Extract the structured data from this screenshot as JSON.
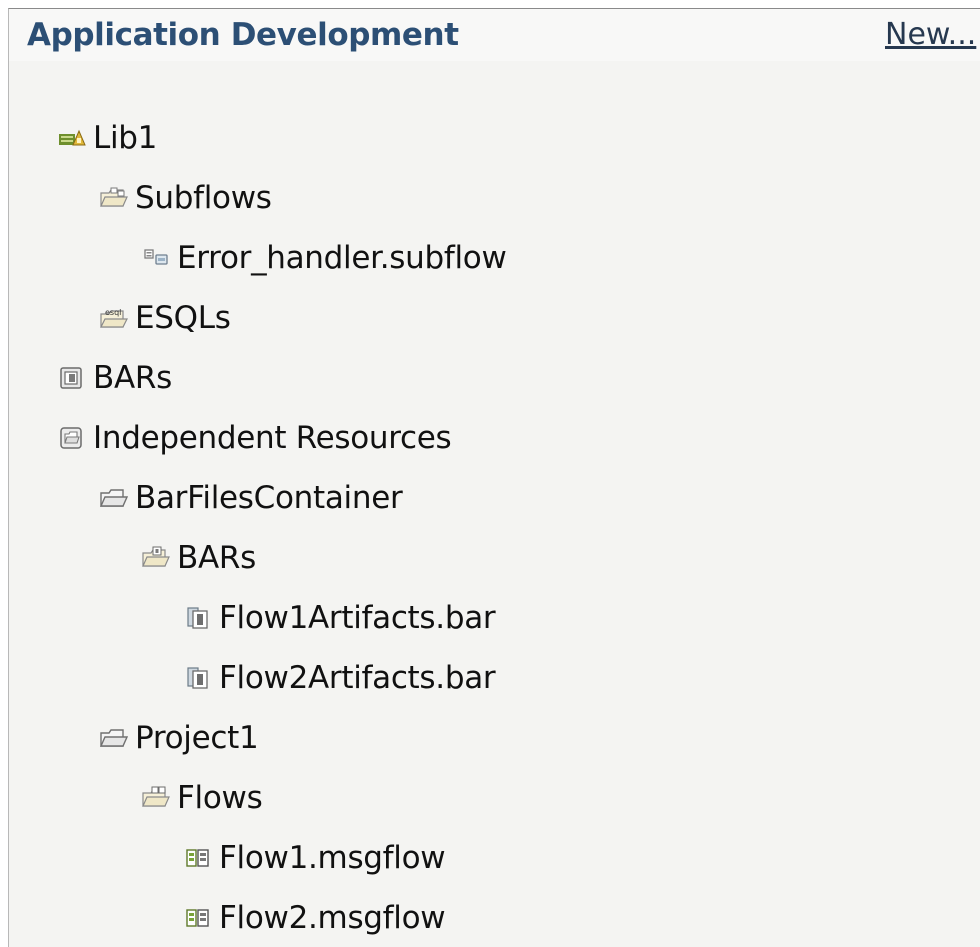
{
  "header": {
    "title": "Application Development",
    "new_link": "New..."
  },
  "tree": [
    {
      "label": "Lib1",
      "icon": "library-icon",
      "name": "tree-node-lib1"
    },
    {
      "label": "Subflows",
      "icon": "subflows-folder-icon",
      "name": "tree-node-subflows"
    },
    {
      "label": "Error_handler.subflow",
      "icon": "subflow-file-icon",
      "name": "tree-node-error-handler-subflow"
    },
    {
      "label": "ESQLs",
      "icon": "esql-folder-icon",
      "name": "tree-node-esqls"
    },
    {
      "label": "BARs",
      "icon": "bars-container-icon",
      "name": "tree-node-bars"
    },
    {
      "label": "Independent Resources",
      "icon": "independent-resources-icon",
      "name": "tree-node-independent-resources"
    },
    {
      "label": "BarFilesContainer",
      "icon": "project-folder-icon",
      "name": "tree-node-barfilescontainer"
    },
    {
      "label": "BARs",
      "icon": "bars-folder-icon",
      "name": "tree-node-bars-folder"
    },
    {
      "label": "Flow1Artifacts.bar",
      "icon": "bar-file-icon",
      "name": "tree-node-flow1artifacts-bar"
    },
    {
      "label": "Flow2Artifacts.bar",
      "icon": "bar-file-icon",
      "name": "tree-node-flow2artifacts-bar"
    },
    {
      "label": "Project1",
      "icon": "project-folder-icon",
      "name": "tree-node-project1"
    },
    {
      "label": "Flows",
      "icon": "flows-folder-icon",
      "name": "tree-node-flows"
    },
    {
      "label": "Flow1.msgflow",
      "icon": "msgflow-file-icon",
      "name": "tree-node-flow1-msgflow"
    },
    {
      "label": "Flow2.msgflow",
      "icon": "msgflow-file-icon",
      "name": "tree-node-flow2-msgflow"
    }
  ]
}
